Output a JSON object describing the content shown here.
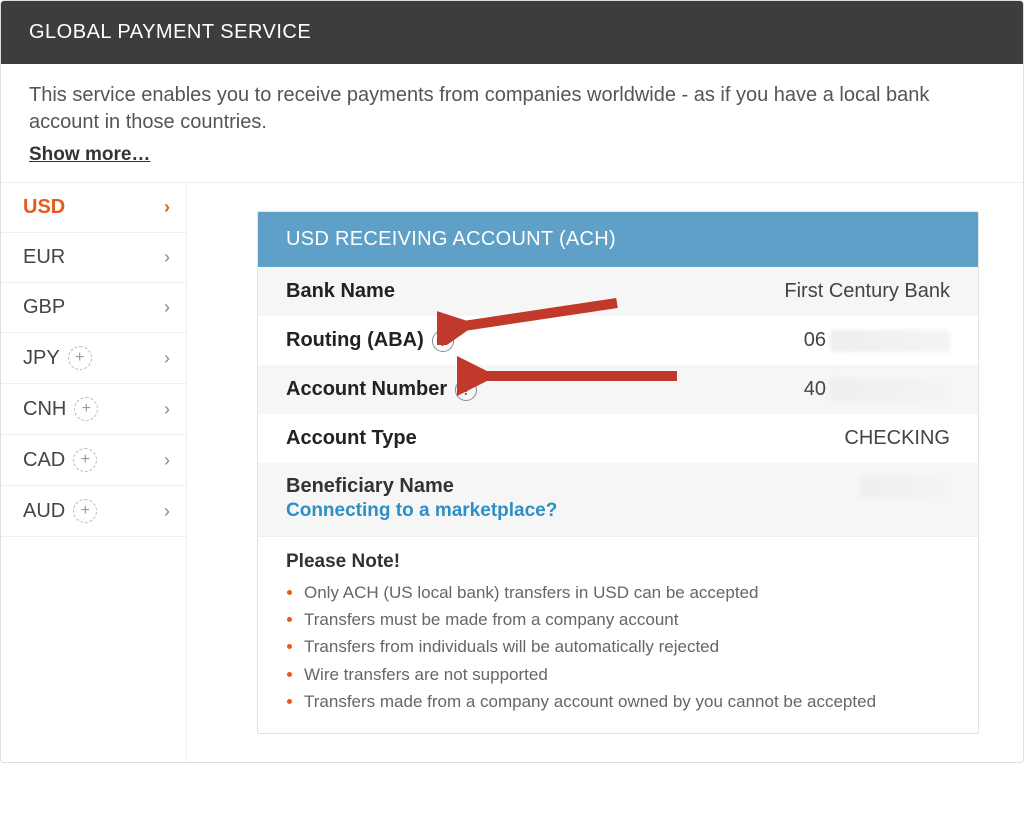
{
  "header": {
    "title": "GLOBAL PAYMENT SERVICE"
  },
  "intro": {
    "text": "This service enables you to receive payments from companies worldwide - as if you have a local bank account in those countries.",
    "show_more": "Show more…"
  },
  "sidebar": {
    "items": [
      {
        "code": "USD",
        "has_plus": false,
        "active": true
      },
      {
        "code": "EUR",
        "has_plus": false,
        "active": false
      },
      {
        "code": "GBP",
        "has_plus": false,
        "active": false
      },
      {
        "code": "JPY",
        "has_plus": true,
        "active": false
      },
      {
        "code": "CNH",
        "has_plus": true,
        "active": false
      },
      {
        "code": "CAD",
        "has_plus": true,
        "active": false
      },
      {
        "code": "AUD",
        "has_plus": true,
        "active": false
      }
    ]
  },
  "card": {
    "title": "USD RECEIVING ACCOUNT (ACH)",
    "bank_name_label": "Bank Name",
    "bank_name_value": "First Century Bank",
    "routing_label": "Routing (ABA)",
    "routing_prefix": "06",
    "account_number_label": "Account Number",
    "account_number_prefix": "40",
    "account_type_label": "Account Type",
    "account_type_value": "CHECKING",
    "beneficiary_label": "Beneficiary Name",
    "marketplace_link": "Connecting to a marketplace?",
    "note_title": "Please Note!",
    "notes": [
      "Only ACH (US local bank) transfers in USD can be accepted",
      "Transfers must be made from a company account",
      "Transfers from individuals will be automatically rejected",
      "Wire transfers are not supported",
      "Transfers made from a company account owned by you cannot be accepted"
    ]
  },
  "icons": {
    "chevron": "›",
    "plus": "+",
    "help": "?"
  }
}
